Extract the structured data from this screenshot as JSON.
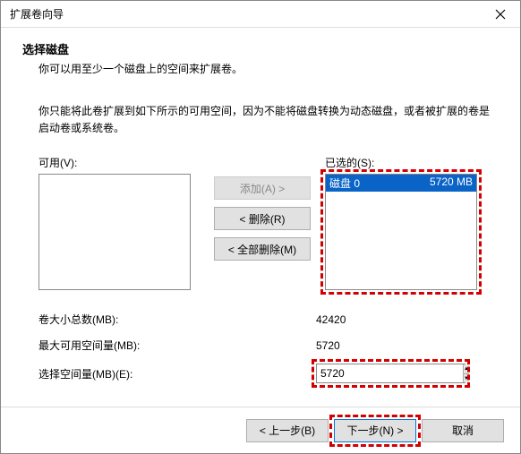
{
  "titlebar": {
    "title": "扩展卷向导"
  },
  "header": {
    "heading": "选择磁盘",
    "subheading": "你可以用至少一个磁盘上的空间来扩展卷。"
  },
  "note": "你只能将此卷扩展到如下所示的可用空间，因为不能将磁盘转换为动态磁盘，或者被扩展的卷是启动卷或系统卷。",
  "lists": {
    "available_label": "可用(V):",
    "selected_label": "已选的(S):",
    "selected_item_disk": "磁盘 0",
    "selected_item_size": "5720 MB"
  },
  "buttons": {
    "add": "添加(A) >",
    "remove": "< 删除(R)",
    "remove_all": "< 全部删除(M)",
    "back": "< 上一步(B)",
    "next": "下一步(N) >",
    "cancel": "取消"
  },
  "fields": {
    "total_label": "卷大小总数(MB):",
    "total_value": "42420",
    "max_label": "最大可用空间量(MB):",
    "max_value": "5720",
    "select_label": "选择空间量(MB)(E):",
    "select_value": "5720"
  }
}
